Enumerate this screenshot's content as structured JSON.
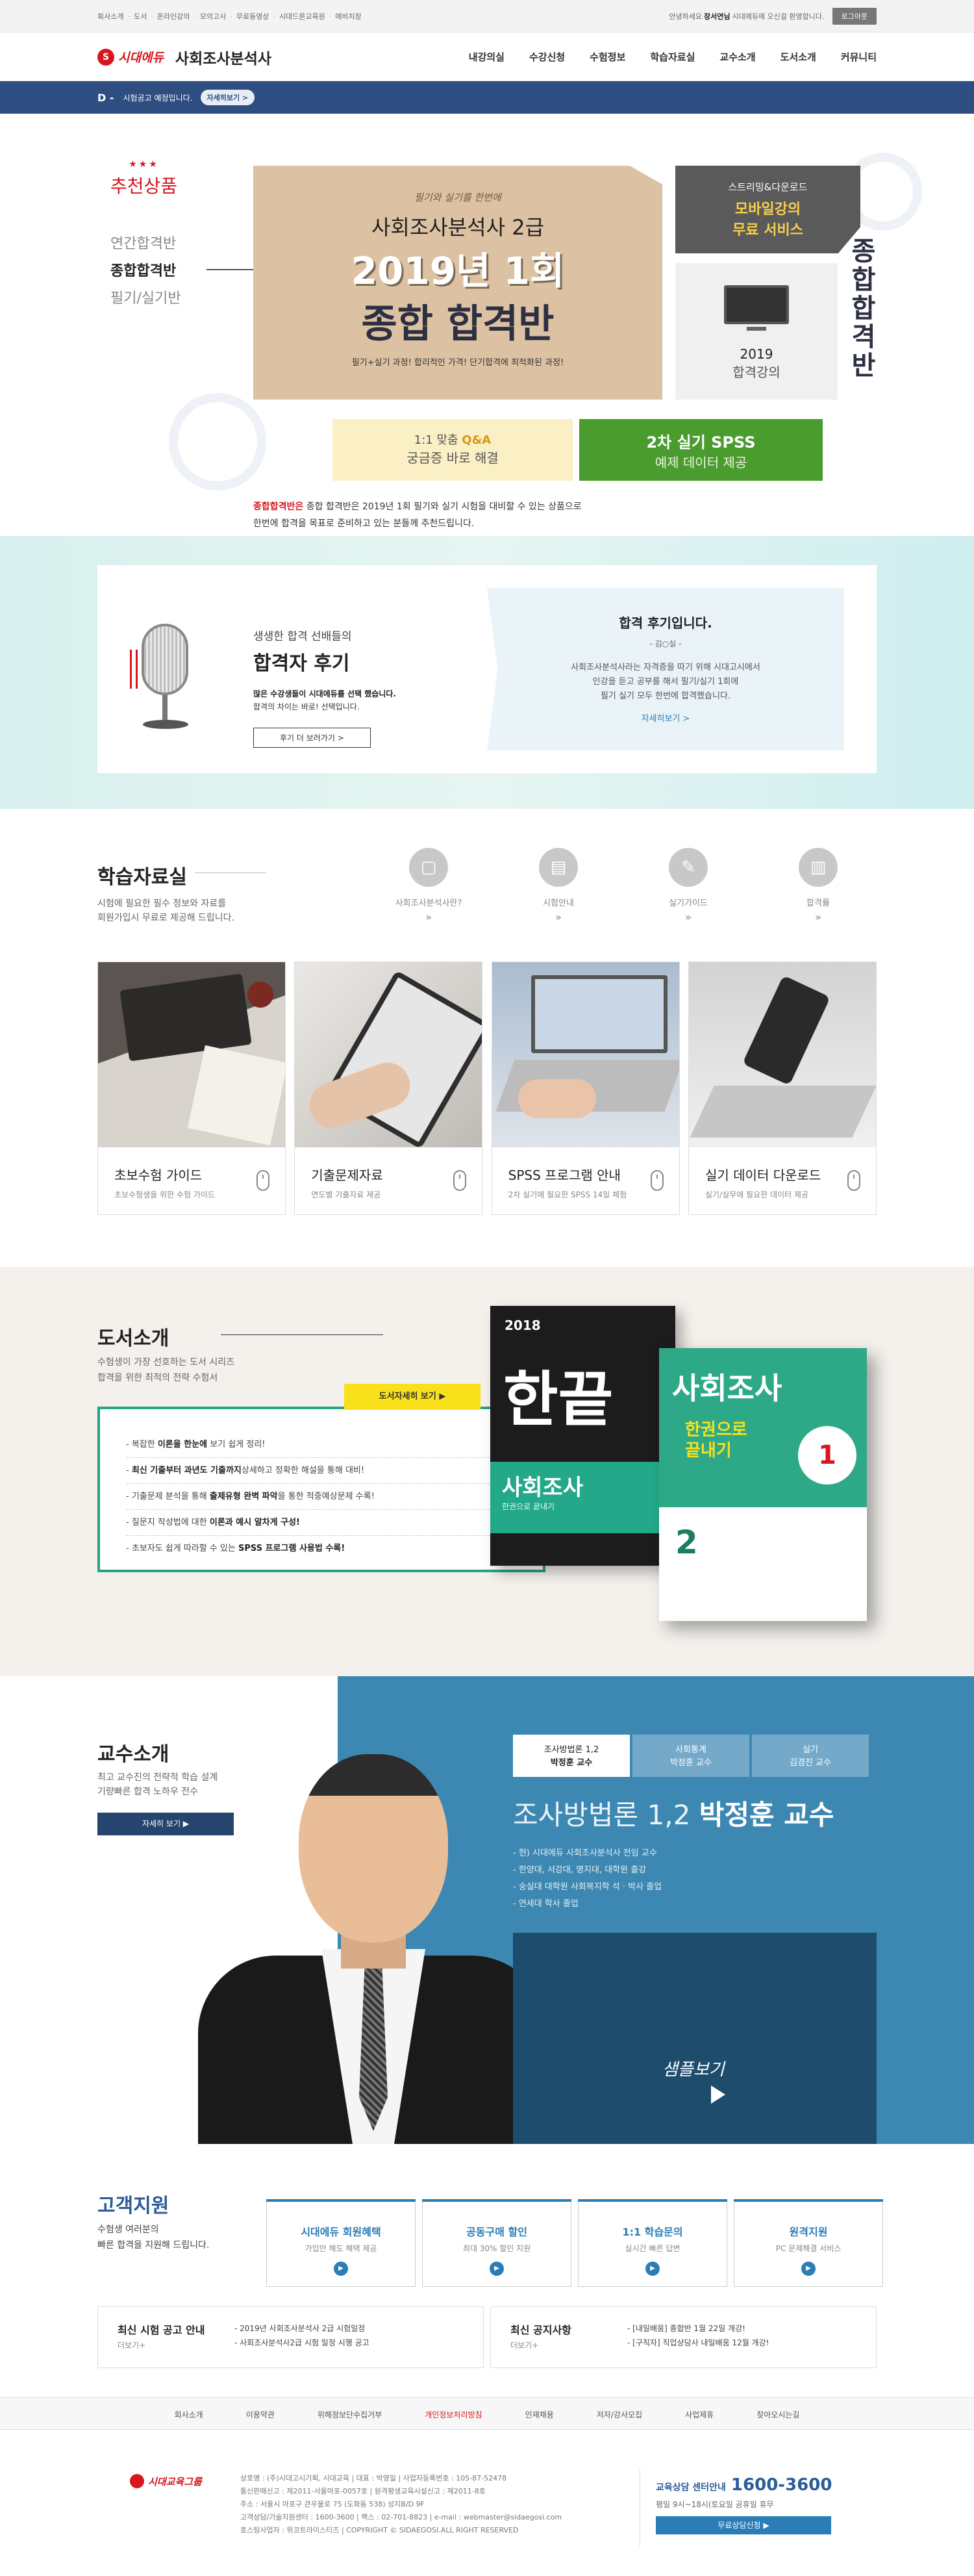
{
  "topbar": {
    "links": [
      "회사소개",
      "도서",
      "온라인강의",
      "모의고사",
      "무료동영상",
      "시대드론교육원",
      "에비치장"
    ],
    "welcome_prefix": "안녕하세요",
    "user_name": "장서연님",
    "welcome_suffix": "시대에듀에 오신걸 환영합니다.",
    "logout_label": "로그아웃"
  },
  "header": {
    "logo_mark": "S",
    "logo_text": "시대에듀",
    "site_name": "사회조사분석사",
    "nav": [
      "내강의실",
      "수강신청",
      "수험정보",
      "학습자료실",
      "교수소개",
      "도서소개",
      "커뮤니티"
    ]
  },
  "notice": {
    "dday": "D -",
    "text": "시험공고 예정입니다.",
    "button": "자세히보기 >"
  },
  "hero": {
    "stars": "★★★",
    "rec_title": "추천상품",
    "rec_items": [
      "연간합격반",
      "종합합격반",
      "필기/실기반"
    ],
    "card_sub": "필기와 실기를 한번에",
    "card_h1": "사회조사분석사 2급",
    "card_h2": "2019년 1회",
    "card_h3": "종합 합격반",
    "card_desc": "필기+실기 과정! 합리적인 가격! 단기합격에 최적화된 과정!",
    "mobile_t1": "스트리밍&다운로드",
    "mobile_t2": "모바일강의",
    "mobile_t3": "무료 서비스",
    "lecture_year": "2019",
    "lecture_label": "합격강의",
    "vertical_title": "종합합격반",
    "qa_pre": "1:1 맞춤",
    "qa_bold": "Q&A",
    "qa_t2": "궁금증 바로 해결",
    "spss_t1": "2차 실기 SPSS",
    "spss_t2": "예제 데이터 제공",
    "desc_bold": "종합합격반은",
    "desc_line1": "종합 합격반은 2019년 1회 필기와 실기 시험을 대비할 수 있는 상품으로",
    "desc_line2": "한번에 합격을 목표로 준비하고 있는 분들께 추천드립니다."
  },
  "review": {
    "left_t1": "생생한 합격 선배들의",
    "left_t2": "합격자 후기",
    "left_t3_bold": "많은 수강생들이 시대에듀를 선택 했습니다.",
    "left_t3": "합격의 차이는 바로! 선택입니다.",
    "button": "후기 더 보러가기 >",
    "right_t1": "합격 후기입니다.",
    "right_t2": "- 김○실 -",
    "right_t3_l1": "사회조사분석사라는 자격증을 따기 위해 시대고시에서",
    "right_t3_l2": "인강을 듣고 공부를 해서 필기/실기 1회에",
    "right_t3_l3": "필기 실기 모두 한번에 합격했습니다.",
    "right_t4": "자세히보기 >"
  },
  "study": {
    "title": "학습자료실",
    "desc_l1": "시험에 필요한 필수 정보와 자료를",
    "desc_l2": "회원가입시 무료로 제공해 드립니다.",
    "icons": [
      {
        "label": "사회조사분석사란?",
        "glyph": "▢",
        "arrow": "»"
      },
      {
        "label": "시험안내",
        "glyph": "▤",
        "arrow": "»"
      },
      {
        "label": "실기가이드",
        "glyph": "✎",
        "arrow": "»"
      },
      {
        "label": "합격률",
        "glyph": "▥",
        "arrow": "»"
      }
    ],
    "cards": [
      {
        "title": "초보수험 가이드",
        "desc": "초보수험생을 위한 수험 가이드"
      },
      {
        "title": "기출문제자료",
        "desc": "연도별 기출자료 제공"
      },
      {
        "title": "SPSS 프로그램 안내",
        "desc": "2차 실기에 필요한 SPSS 14일 체험"
      },
      {
        "title": "실기 데이터 다운로드",
        "desc": "실기/실무에 필요한 데이터 제공"
      }
    ]
  },
  "book": {
    "title": "도서소개",
    "desc_l1": "수험생이 가장 선호하는 도서 시리즈",
    "desc_l2": "합격을 위한 최적의 전략 수험서",
    "button": "도서자세히 보기 ▶",
    "items": [
      {
        "pre": "- 복잡한 ",
        "bold": "이론을 한눈에",
        "post": " 보기 쉽게 정리!"
      },
      {
        "pre": "- ",
        "bold": "최신 기출부터 과년도 기출까지",
        "post": "상세하고 정확한 해설을 통해 대비!"
      },
      {
        "pre": "- 기출문제 분석을 통해 ",
        "bold": "출제유형 완벽 파악",
        "post": "을 통한 적중예상문제 수록!"
      },
      {
        "pre": "- 질문지 작성법에 대한 ",
        "bold": "이론과 예시 알차게 구성!",
        "post": ""
      },
      {
        "pre": "- 초보자도 쉽게 따라할 수 있는 ",
        "bold": "SPSS 프로그램 사용법 수록!",
        "post": ""
      }
    ],
    "book1_year": "2018",
    "book1_big": "한끝",
    "book1_title": "사회조사",
    "book1_sub": "한권으로 끝내기",
    "book2_title": "사회조사",
    "book2_sub_l1": "한권으로",
    "book2_sub_l2": "끝내기",
    "book2_num": "2",
    "book2_badge": "1"
  },
  "prof": {
    "title": "교수소개",
    "desc_l1": "최고 교수진의 전략적 학습 설계",
    "desc_l2": "기량빠른 합격 노하우 전수",
    "button": "자세히 보기 ▶",
    "tabs": [
      {
        "l1": "조사방법론 1,2",
        "l2": "박정훈 교수"
      },
      {
        "l1": "사회통계",
        "l2": "박정훈 교수"
      },
      {
        "l1": "실기",
        "l2": "김경진 교수"
      }
    ],
    "name_pre": "조사방법론 1,2 ",
    "name_bold": "박정훈 교수",
    "info": [
      "- 현) 시대에듀 사회조사분석사 전임 교수",
      "- 한양대, 서강대, 명지대, 대학원 출강",
      "- 숭실대 대학원 사회복지학 석 · 박사 졸업",
      "- 연세대 학사 졸업"
    ],
    "video_label": "샘플보기"
  },
  "support": {
    "title": "고객지원",
    "desc_l1": "수험생 여러분의",
    "desc_l2": "빠른 합격을 지원해 드립니다.",
    "cards": [
      {
        "title": "시대에듀 회원혜택",
        "desc": "가입만 해도 혜택 제공"
      },
      {
        "title": "공동구매 할인",
        "desc": "최대 30% 할인 지원"
      },
      {
        "title": "1:1 학습문의",
        "desc": "실시간 빠른 답변"
      },
      {
        "title": "원격지원",
        "desc": "PC 문제해결 서비스"
      }
    ],
    "notice1_title": "최신 시험 공고 안내",
    "notice1_more": "더보기+",
    "notice1_items": [
      "- 2019년 사회조사분석사 2급 시험일정",
      "- 사회조사분석사2급 시험 일정 시행 공고"
    ],
    "notice2_title": "최신 공지사항",
    "notice2_more": "더보기+",
    "notice2_items": [
      "- [내일배움] 종합반 1월 22일 개강!",
      "- [구직자] 직업상담사 내일배움 12월 개강!"
    ]
  },
  "footer": {
    "nav": [
      "회사소개",
      "이용약관",
      "위해정보단수집거부",
      "개인정보처리방침",
      "인재채용",
      "저자/강사모집",
      "사업제휴",
      "찾아오시는길"
    ],
    "logo_text": "시대교육그룹",
    "info": [
      "상호명 : (주)시대고시기획, 시대교육 | 대표 : 박영일 | 사업자등록번호 : 105-87-52478",
      "통신판매신고 : 제2011-서울마포-0057호 | 원격평생교육시설신고 : 제2011-8호",
      "주소 : 서울시 마포구 큰우물로 75 (도화동 538) 성지B/D 9F",
      "고객상담/기술지원센터 : 1600-3600 | 팩스 : 02-701-8823 | e-mail : webmaster@sidaegosi.com",
      "호스팅사업자 : 위코트라이스티즈 | COPYRIGHT © SIDAEGOSI.ALL RIGHT RESERVED"
    ],
    "cs_label": "교육상담 센터안내",
    "cs_number": "1600-3600",
    "cs_hours": "평일 9시~18시(토요일 공휴일 휴무",
    "cs_button": "무료상담신청 ▶"
  },
  "colors": {
    "brand_red": "#d7161e",
    "navy": "#2e4d80",
    "teal": "#26a485",
    "prof_blue": "#3d88b3",
    "support_blue": "#2b7db8"
  }
}
